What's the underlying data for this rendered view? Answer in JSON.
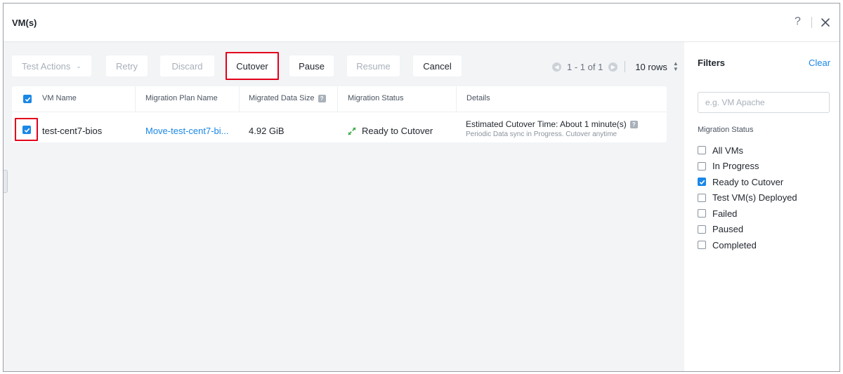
{
  "dialog": {
    "title": "VM(s)",
    "help_glyph": "?"
  },
  "toolbar": {
    "test_actions_label": "Test Actions",
    "retry_label": "Retry",
    "discard_label": "Discard",
    "cutover_label": "Cutover",
    "pause_label": "Pause",
    "resume_label": "Resume",
    "cancel_label": "Cancel"
  },
  "pagination": {
    "range_text": "1 - 1 of 1",
    "rows_label": "10 rows"
  },
  "table": {
    "headers": {
      "vm_name": "VM Name",
      "migration_plan_name": "Migration Plan Name",
      "migrated_data_size": "Migrated Data Size",
      "migration_status": "Migration Status",
      "details": "Details"
    },
    "rows": [
      {
        "vm_name": "test-cent7-bios",
        "migration_plan": "Move-test-cent7-bi...",
        "data_size": "4.92 GiB",
        "status": "Ready to Cutover",
        "details_main": "Estimated Cutover Time: About 1 minute(s)",
        "details_sub": "Periodic Data sync in Progress. Cutover anytime"
      }
    ]
  },
  "filters": {
    "title": "Filters",
    "clear_label": "Clear",
    "search_placeholder": "e.g. VM Apache",
    "section_label": "Migration Status",
    "options": [
      {
        "label": "All VMs",
        "checked": false
      },
      {
        "label": "In Progress",
        "checked": false
      },
      {
        "label": "Ready to Cutover",
        "checked": true
      },
      {
        "label": "Test VM(s) Deployed",
        "checked": false
      },
      {
        "label": "Failed",
        "checked": false
      },
      {
        "label": "Paused",
        "checked": false
      },
      {
        "label": "Completed",
        "checked": false
      }
    ]
  },
  "colors": {
    "accent": "#1b87e6",
    "highlight": "#e3001b",
    "status_ok": "#3fae49"
  }
}
